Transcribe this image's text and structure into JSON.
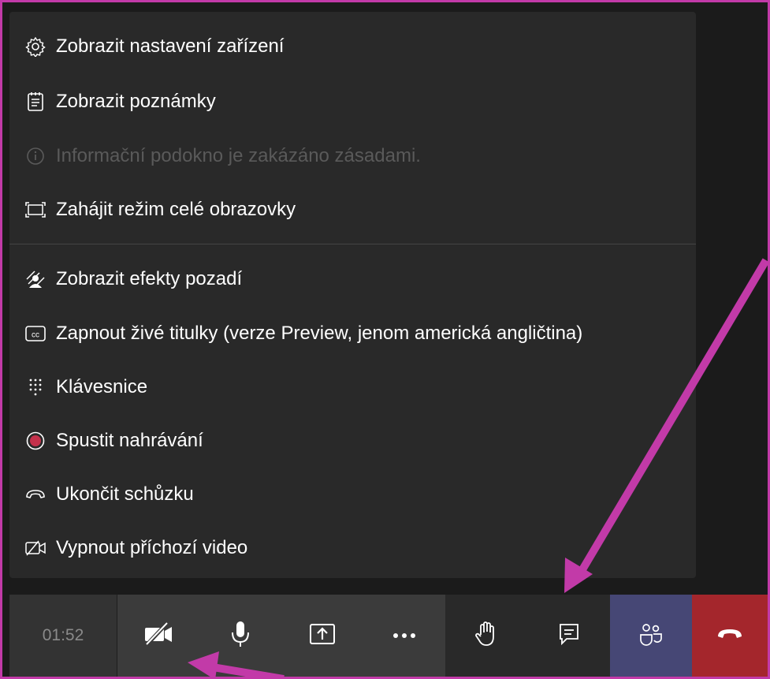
{
  "menu": {
    "items": [
      {
        "label": "Zobrazit nastavení zařízení",
        "icon": "gear-icon",
        "disabled": false
      },
      {
        "label": "Zobrazit poznámky",
        "icon": "notes-icon",
        "disabled": false
      },
      {
        "label": "Informační podokno je zakázáno zásadami.",
        "icon": "info-icon",
        "disabled": true
      },
      {
        "label": "Zahájit režim celé obrazovky",
        "icon": "fullscreen-icon",
        "disabled": false
      },
      {
        "label": "Zobrazit efekty pozadí",
        "icon": "background-effects-icon",
        "disabled": false
      },
      {
        "label": "Zapnout živé titulky (verze Preview, jenom americká angličtina)",
        "icon": "captions-icon",
        "disabled": false
      },
      {
        "label": "Klávesnice",
        "icon": "dialpad-icon",
        "disabled": false
      },
      {
        "label": "Spustit nahrávání",
        "icon": "record-icon",
        "disabled": false
      },
      {
        "label": "Ukončit schůzku",
        "icon": "end-meeting-icon",
        "disabled": false
      },
      {
        "label": "Vypnout příchozí video",
        "icon": "incoming-video-off-icon",
        "disabled": false
      }
    ]
  },
  "toolbar": {
    "timer": "01:52",
    "buttons": [
      "camera-off-icon",
      "microphone-icon",
      "share-screen-icon",
      "more-options-icon",
      "raise-hand-icon",
      "chat-icon",
      "participants-icon",
      "hang-up-icon"
    ]
  },
  "colors": {
    "frame": "#c23aa8",
    "arrow": "#c23aa8",
    "menu_bg": "#292929",
    "participants_bg": "#464775",
    "hangup_bg": "#a4262c",
    "record": "#c4314b"
  }
}
